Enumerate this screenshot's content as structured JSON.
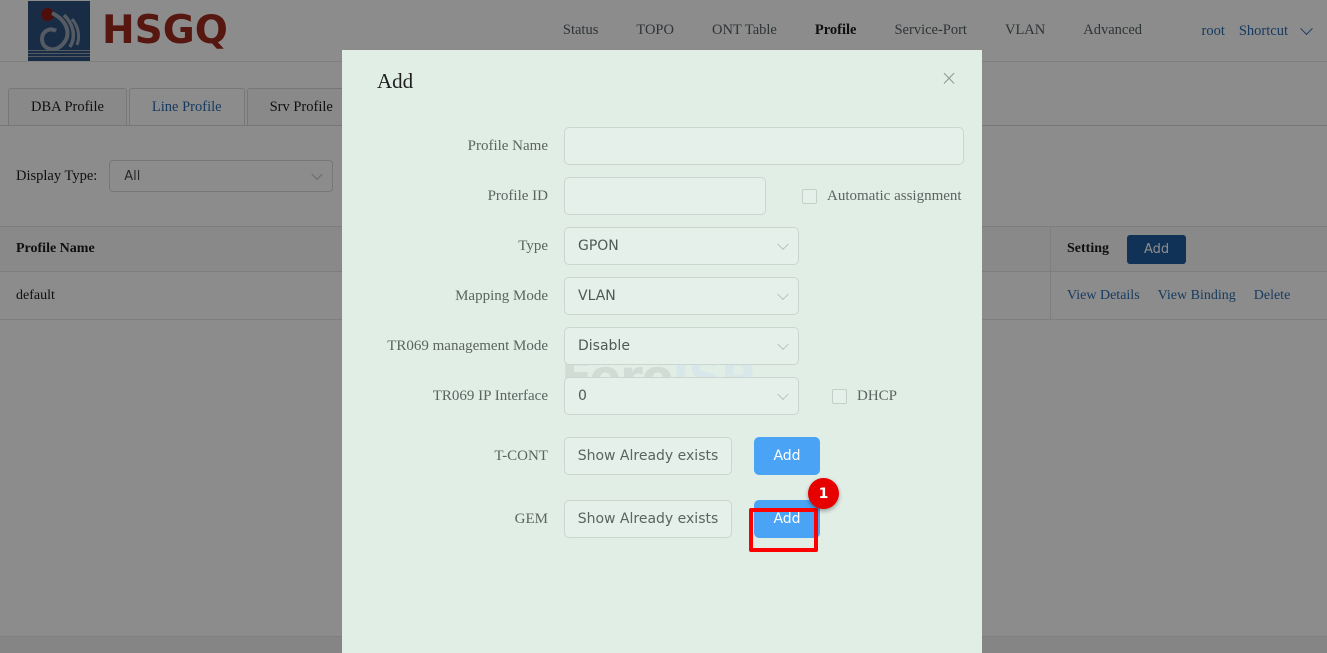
{
  "brand": {
    "name": "HSGQ",
    "logo_icon": "hsgq-logo-icon"
  },
  "nav": {
    "items": [
      {
        "label": "Status",
        "active": false
      },
      {
        "label": "TOPO",
        "active": false
      },
      {
        "label": "ONT Table",
        "active": false
      },
      {
        "label": "Profile",
        "active": true
      },
      {
        "label": "Service-Port",
        "active": false
      },
      {
        "label": "VLAN",
        "active": false
      },
      {
        "label": "Advanced",
        "active": false
      }
    ],
    "user": "root",
    "shortcut": "Shortcut",
    "shortcut_icon": "chevron-down-icon"
  },
  "tabs": [
    {
      "label": "DBA Profile",
      "active": false
    },
    {
      "label": "Line Profile",
      "active": true
    },
    {
      "label": "Srv Profile",
      "active": false
    }
  ],
  "filter": {
    "label": "Display Type:",
    "value": "All",
    "chevron_icon": "chevron-down-icon"
  },
  "table": {
    "columns": [
      "Profile Name",
      "Setting"
    ],
    "header_add_label": "Add",
    "rows": [
      {
        "profile_name": "default",
        "actions": [
          "View Details",
          "View Binding",
          "Delete"
        ]
      }
    ]
  },
  "modal": {
    "title": "Add",
    "close_icon": "close-icon",
    "watermark": {
      "part1": "Foro",
      "part2": "ISP",
      "icon": "wifi-arc-icon"
    },
    "fields": {
      "profile_name": {
        "label": "Profile Name",
        "value": "",
        "placeholder": ""
      },
      "profile_id": {
        "label": "Profile ID",
        "value": "",
        "placeholder": ""
      },
      "automatic_assignment": {
        "label": "Automatic assignment",
        "checked": false
      },
      "type": {
        "label": "Type",
        "value": "GPON",
        "chevron_icon": "chevron-down-icon"
      },
      "mapping_mode": {
        "label": "Mapping Mode",
        "value": "VLAN",
        "chevron_icon": "chevron-down-icon"
      },
      "tr069_management_mode": {
        "label": "TR069 management Mode",
        "value": "Disable",
        "chevron_icon": "chevron-down-icon"
      },
      "tr069_ip_interface": {
        "label": "TR069 IP Interface",
        "value": "0",
        "chevron_icon": "chevron-down-icon"
      },
      "dhcp": {
        "label": "DHCP",
        "checked": false
      },
      "tcont": {
        "label": "T-CONT",
        "show_label": "Show Already exists",
        "add_label": "Add"
      },
      "gem": {
        "label": "GEM",
        "show_label": "Show Already exists",
        "add_label": "Add"
      }
    }
  },
  "annotation": {
    "badge": "1",
    "target": "tcont-add-button",
    "color": "#ff0000"
  }
}
